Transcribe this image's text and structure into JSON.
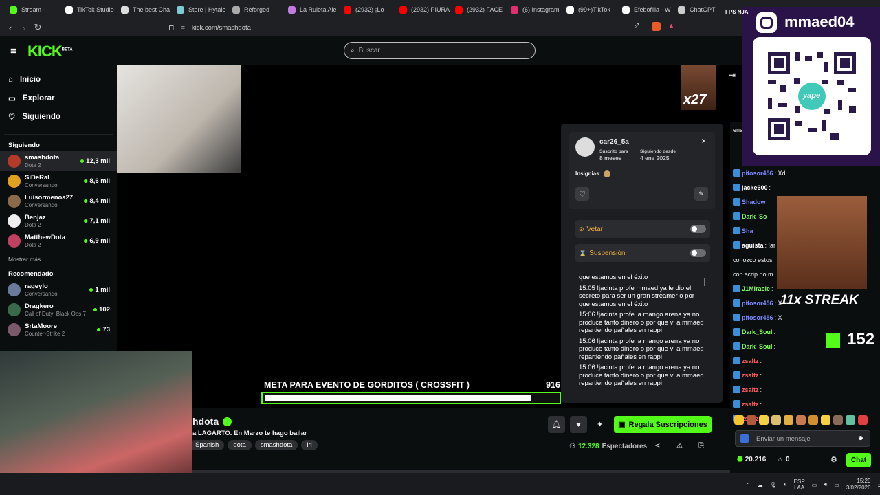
{
  "tabs": [
    {
      "label": "Stream - ",
      "color": "#53fc18"
    },
    {
      "label": "TikTok Studio",
      "color": "#ffffff"
    },
    {
      "label": "The best Cha",
      "color": "#dddddd"
    },
    {
      "label": "Store | Hytale",
      "color": "#7ecbd6"
    },
    {
      "label": "Reforged",
      "color": "#aaaaaa"
    },
    {
      "label": "La Ruleta Ale",
      "color": "#c07ae0"
    },
    {
      "label": "(2932) ¡Lo",
      "color": "#ff0000"
    },
    {
      "label": "(2932) PIURA",
      "color": "#ff0000"
    },
    {
      "label": "(2932) FACE",
      "color": "#ff0000"
    },
    {
      "label": "(6) Instagram",
      "color": "#e1306c"
    },
    {
      "label": "(99+)TikTok",
      "color": "#ffffff"
    },
    {
      "label": "Efebofilia - W",
      "color": "#ffffff"
    },
    {
      "label": "ChatGPT",
      "color": "#cccccc"
    }
  ],
  "url": "kick.com/smashdota",
  "logo": "KICK",
  "logo_beta": "BETA",
  "search_placeholder": "Buscar",
  "nav": {
    "home": "Inicio",
    "browse": "Explorar",
    "following": "Siguiendo"
  },
  "following_title": "Siguiendo",
  "following": [
    {
      "name": "smashdota",
      "category": "Dota 2",
      "viewers": "12,3 mil",
      "color": "#b43a2a"
    },
    {
      "name": "SiDeRaL",
      "category": "Conversando",
      "viewers": "8,6 mil",
      "color": "#e0a020"
    },
    {
      "name": "Luisormenoa27",
      "category": "Conversando",
      "viewers": "8,4 mil",
      "color": "#8a6a4a"
    },
    {
      "name": "Benjaz",
      "category": "Dota 2",
      "viewers": "7,1 mil",
      "color": "#eeeeee"
    },
    {
      "name": "MatthewDota",
      "category": "Dota 2",
      "viewers": "6,9 mil",
      "color": "#c04060"
    }
  ],
  "show_more": "Mostrar más",
  "recommended_title": "Recomendado",
  "recommended": [
    {
      "name": "rageylo",
      "category": "Conversando",
      "viewers": "1 mil",
      "color": "#6a7a9a"
    },
    {
      "name": "Dragkero",
      "category": "Call of Duty: Black Ops 7",
      "viewers": "102",
      "color": "#3a6a4a"
    },
    {
      "name": "SrtaMoore",
      "category": "Counter-Strike 2",
      "viewers": "73",
      "color": "#7a5a6a"
    }
  ],
  "overlay": {
    "x27": "x27",
    "streak": "11x STREAK",
    "kick_count": "152",
    "instagram": "mmaed04",
    "yape": "yape"
  },
  "goal": {
    "label": "META PARA EVENTO DE GORDITOS ( CROSSFIT )",
    "count": "916",
    "progress": 0.9
  },
  "popup": {
    "username": "car26_5a",
    "subscribed_label": "Suscrito para",
    "subscribed_value": "8 meses",
    "following_label": "Siguiendo desde",
    "following_value": "4 ene 2025",
    "badges_label": "Insignias",
    "ban_label": "Vetar",
    "timeout_label": "Suspensión",
    "messages": [
      {
        "time": "",
        "text": "que estamos en el éxito"
      },
      {
        "time": "15:05",
        "text": "!jacinta profe mmaed ya le dio el secreto para ser un gran streamer o por que estamos en el éxito"
      },
      {
        "time": "15:06",
        "text": "!jacinta profe la mango arena ya no produce tanto dinero o por que vi a mmaed repartiendo pañales en rappi"
      },
      {
        "time": "15:06",
        "text": "!jacinta profe la mango arena ya no produce tanto dinero o por que vi a mmaed repartiendo pañales en rappi"
      },
      {
        "time": "15:06",
        "text": "!jacinta profe la mango arena ya no produce tanto dinero o por que vi a mmaed repartiendo pañales en rappi"
      }
    ]
  },
  "chat": {
    "lines": [
      {
        "user": "",
        "text": "ens",
        "color": "#ffffff"
      },
      {
        "user": "",
        "text": "",
        "color": "#ffffff"
      },
      {
        "user": "",
        "text": "",
        "color": "#ffffff"
      },
      {
        "user": "pitosor456",
        "text": ": Xd",
        "color": "#7e8aff"
      },
      {
        "user": "jacke600",
        "text": ":",
        "color": "#ffffff"
      },
      {
        "user": "Shadow",
        "text": "",
        "color": "#7e8aff"
      },
      {
        "user": "Dark_So",
        "text": "",
        "color": "#7fff5a"
      },
      {
        "user": "Sha",
        "text": "",
        "color": "#7e8aff"
      },
      {
        "user": "aguista",
        "text": ": !ar",
        "color": "#ffffff"
      },
      {
        "user": "",
        "text": "conozco estos",
        "color": "#ffffff"
      },
      {
        "user": "",
        "text": "con scrip no m",
        "color": "#ffffff"
      },
      {
        "user": "J1Miracle",
        "text": ":",
        "color": "#7fff5a"
      },
      {
        "user": "pitosor456",
        "text": ": X",
        "color": "#7e8aff"
      },
      {
        "user": "pitosor456",
        "text": ": X",
        "color": "#7e8aff"
      },
      {
        "user": "Dark_Soul",
        "text": ":",
        "color": "#7fff5a"
      },
      {
        "user": "Dark_Soul",
        "text": ":",
        "color": "#7fff5a"
      },
      {
        "user": "zsaltz",
        "text": ":",
        "color": "#ff5a5a"
      },
      {
        "user": "zsaltz",
        "text": ":",
        "color": "#ff5a5a"
      },
      {
        "user": "zsaltz",
        "text": ":",
        "color": "#ff5a5a"
      },
      {
        "user": "zsaltz",
        "text": ":",
        "color": "#ff5a5a"
      },
      {
        "user": "zsaltz",
        "text": ":",
        "color": "#ff5a5a"
      }
    ],
    "input_placeholder": "Enviar un mensaje",
    "points": "20.216",
    "bets": "0",
    "send_label": "Chat"
  },
  "channel": {
    "name": "hdota",
    "title": "a LAGARTO. En Marzo te hago bailar",
    "tags": [
      "Spanish",
      "dota",
      "smashdota",
      "irl"
    ],
    "viewers": "12.328",
    "viewers_label": "Espectadores",
    "subscribe_label": "Regala Suscripciones"
  },
  "system": {
    "lang": "ESP",
    "layout": "LAA",
    "time": "15:29",
    "date": "3/02/2026",
    "fps_label": "FPS",
    "extra": "NJA"
  }
}
